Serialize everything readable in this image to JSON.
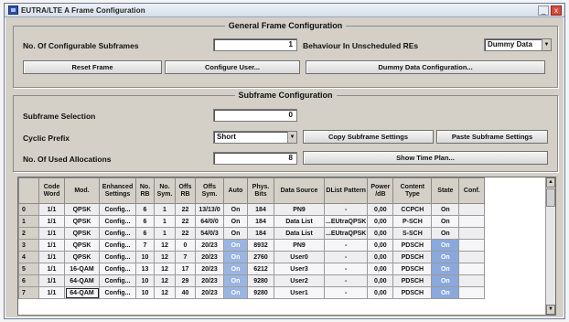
{
  "window": {
    "title": "EUTRA/LTE A Frame Configuration",
    "min": "_",
    "close": "x"
  },
  "general": {
    "title": "General Frame Configuration",
    "num_subframes_label": "No. Of Configurable Subframes",
    "num_subframes_value": "1",
    "behaviour_label": "Behaviour In Unscheduled REs",
    "behaviour_value": "Dummy Data",
    "reset_button": "Reset Frame",
    "configure_user_button": "Configure User...",
    "dummy_data_button": "Dummy Data Configuration..."
  },
  "subframe": {
    "title": "Subframe Configuration",
    "selection_label": "Subframe Selection",
    "selection_value": "0",
    "cyclic_prefix_label": "Cyclic Prefix",
    "cyclic_prefix_value": "Short",
    "copy_button": "Copy Subframe Settings",
    "paste_button": "Paste Subframe Settings",
    "allocations_label": "No. Of Used Allocations",
    "allocations_value": "8",
    "show_time_plan_button": "Show Time Plan..."
  },
  "table": {
    "headers": [
      "",
      "Code Word",
      "Mod.",
      "Enhanced Settings",
      "No. RB",
      "No. Sym.",
      "Offs RB",
      "Offs Sym.",
      "Auto",
      "Phys. Bits",
      "Data Source",
      "DList Pattern",
      "Power /dB",
      "Content Type",
      "State",
      "Conf."
    ],
    "rows": [
      [
        "0",
        "1/1",
        "QPSK",
        "Config...",
        "6",
        "1",
        "22",
        "13/13/0",
        "On",
        "184",
        "PN9",
        "-",
        "0,00",
        "CCPCH",
        "On",
        ""
      ],
      [
        "1",
        "1/1",
        "QPSK",
        "Config...",
        "6",
        "1",
        "22",
        "64/0/0",
        "On",
        "184",
        "Data List",
        "...EUtraQPSK",
        "0,00",
        "P-SCH",
        "On",
        ""
      ],
      [
        "2",
        "1/1",
        "QPSK",
        "Config...",
        "6",
        "1",
        "22",
        "54/0/3",
        "On",
        "184",
        "Data List",
        "...EUtraQPSK",
        "0,00",
        "S-SCH",
        "On",
        ""
      ],
      [
        "3",
        "1/1",
        "QPSK",
        "Config...",
        "7",
        "12",
        "0",
        "20/23",
        "On",
        "8932",
        "PN9",
        "-",
        "0,00",
        "PDSCH",
        "On",
        ""
      ],
      [
        "4",
        "1/1",
        "QPSK",
        "Config...",
        "10",
        "12",
        "7",
        "20/23",
        "On",
        "2760",
        "User0",
        "-",
        "0,00",
        "PDSCH",
        "On",
        ""
      ],
      [
        "5",
        "1/1",
        "16-QAM",
        "Config...",
        "13",
        "12",
        "17",
        "20/23",
        "On",
        "6212",
        "User3",
        "-",
        "0,00",
        "PDSCH",
        "On",
        ""
      ],
      [
        "6",
        "1/1",
        "64-QAM",
        "Config...",
        "10",
        "12",
        "29",
        "20/23",
        "On",
        "9280",
        "User2",
        "-",
        "0,00",
        "PDSCH",
        "On",
        ""
      ],
      [
        "7",
        "1/1",
        "64-QAM",
        "Config...",
        "10",
        "12",
        "40",
        "20/23",
        "On",
        "9280",
        "User1",
        "-",
        "0,00",
        "PDSCH",
        "On",
        ""
      ]
    ]
  }
}
